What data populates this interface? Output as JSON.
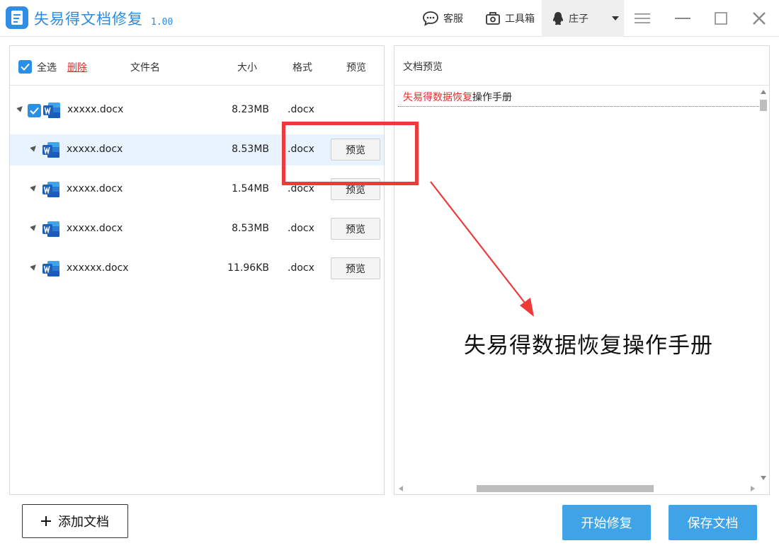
{
  "app": {
    "title": "失易得文档修复",
    "version": "1.00"
  },
  "toolbar": {
    "support_label": "客服",
    "tools_label": "工具箱",
    "user_name": "庄子"
  },
  "file_list": {
    "select_all_label": "全选",
    "delete_label": "删除",
    "columns": {
      "name": "文件名",
      "size": "大小",
      "format": "格式",
      "preview": "预览"
    },
    "rows": [
      {
        "name": "xxxxx.docx",
        "size": "8.23MB",
        "format": ".docx",
        "preview": ""
      },
      {
        "name": "xxxxx.docx",
        "size": "8.53MB",
        "format": ".docx",
        "preview": "预览"
      },
      {
        "name": "xxxxx.docx",
        "size": "1.54MB",
        "format": ".docx",
        "preview": "预览"
      },
      {
        "name": "xxxxx.docx",
        "size": "8.53MB",
        "format": ".docx",
        "preview": "预览"
      },
      {
        "name": "xxxxxx.docx",
        "size": "11.96KB",
        "format": ".docx",
        "preview": "预览"
      }
    ]
  },
  "preview_panel": {
    "title": "文档预览",
    "line_highlight": "失易得数据恢复",
    "line_rest": "操作手册",
    "caption": "失易得数据恢复操作手册"
  },
  "actions": {
    "add_doc": "添加文档",
    "start_repair": "开始修复",
    "save_doc": "保存文档"
  },
  "colors": {
    "accent": "#2b8bdf",
    "primary_button": "#3fa3e8",
    "annotation": "#ee3a3a",
    "delete_link": "#d9302f",
    "selected_row": "#e8f3fd"
  }
}
